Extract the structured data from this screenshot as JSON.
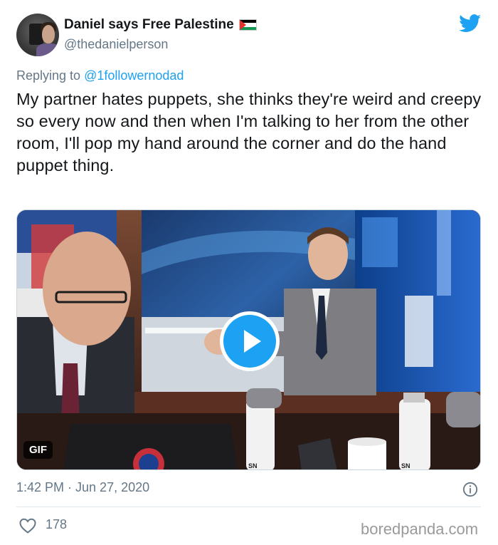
{
  "author": {
    "display_name": "Daniel says Free Palestine",
    "handle": "@thedanielperson"
  },
  "reply": {
    "prefix": "Replying to ",
    "mention": "@1followernodad"
  },
  "tweet_text": "My partner hates puppets, she thinks they're weird and creepy so every now and then when I'm talking to her from the other room, I'll pop my hand around the corner and do the hand puppet thing.",
  "media": {
    "badge": "GIF",
    "desk_logo_left": "SN",
    "desk_logo_right": "SN"
  },
  "footer": {
    "timestamp": "1:42 PM · Jun 27, 2020",
    "like_count": "178"
  },
  "watermark": "boredpanda.com",
  "colors": {
    "accent": "#1da1f2",
    "muted": "#657786",
    "text": "#14171a"
  },
  "icons": [
    "twitter-bird-icon",
    "palestine-flag-icon",
    "play-icon",
    "info-icon",
    "heart-icon"
  ]
}
